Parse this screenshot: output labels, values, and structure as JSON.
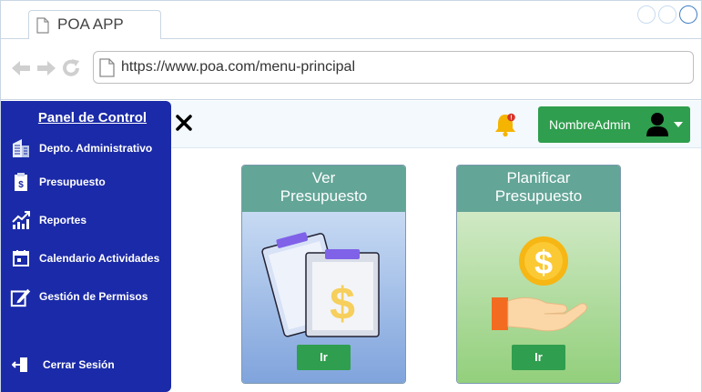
{
  "browser": {
    "tab_title": "POA APP",
    "url": "https://www.poa.com/menu-principal"
  },
  "topbar": {
    "user_name": "NombreAdmin",
    "notification_badge": "!"
  },
  "sidebar": {
    "title": "Panel de Control",
    "items": [
      {
        "label": "Depto. Administrativo",
        "icon": "building-icon"
      },
      {
        "label": "Presupuesto",
        "icon": "budget-document-icon"
      },
      {
        "label": "Reportes",
        "icon": "chart-icon"
      },
      {
        "label": "Calendario Actividades",
        "icon": "calendar-icon"
      },
      {
        "label": "Gestión de Permisos",
        "icon": "permissions-edit-icon"
      }
    ],
    "logout_label": "Cerrar Sesión"
  },
  "cards": [
    {
      "title_line1": "Ver",
      "title_line2": "Presupuesto",
      "button_label": "Ir",
      "icon": "clipboard-dollar-icon"
    },
    {
      "title_line1": "Planificar",
      "title_line2": "Presupuesto",
      "button_label": "Ir",
      "icon": "hand-coin-icon"
    }
  ],
  "colors": {
    "sidebar_bg": "#1b2aa8",
    "accent_green": "#2f9e4e",
    "card_header": "#63a597"
  }
}
